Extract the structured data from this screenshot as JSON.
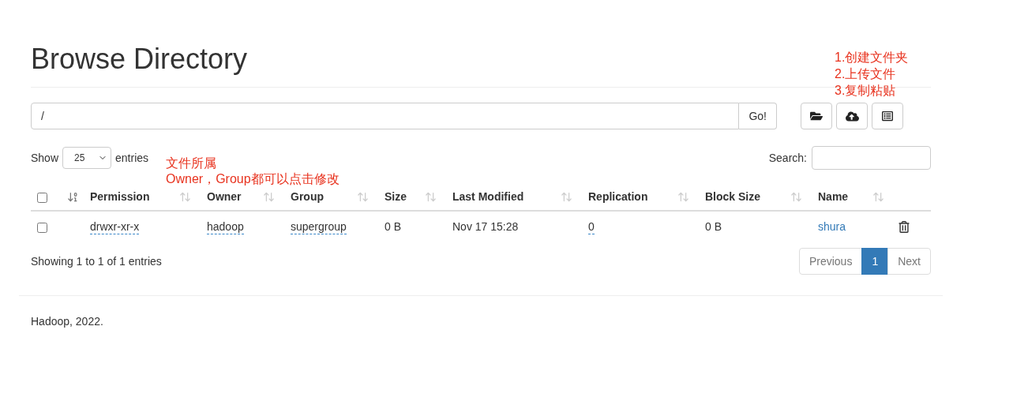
{
  "title": "Browse Directory",
  "path_field": {
    "value": "/"
  },
  "go_button": "Go!",
  "annotations": [
    {
      "lines": [
        "1.创建文件夹",
        "2.上传文件",
        "3.复制粘贴"
      ]
    },
    {
      "lines": [
        "文件所属",
        "Owner，Group都可以点击修改"
      ]
    }
  ],
  "length_control": {
    "before": "Show",
    "value": "25",
    "after": "entries"
  },
  "search": {
    "label": "Search:"
  },
  "select_all": {
    "checked": false
  },
  "columns": [
    {
      "sorted": true
    },
    {
      "label": "Permission",
      "sorted": false
    },
    {
      "label": "Owner",
      "sorted": false
    },
    {
      "label": "Group",
      "sorted": false
    },
    {
      "label": "Size",
      "sorted": false
    },
    {
      "label": "Last Modified",
      "sorted": false
    },
    {
      "label": "Replication",
      "sorted": false
    },
    {
      "label": "Block Size",
      "sorted": false
    },
    {
      "label": "Name",
      "sorted": false
    }
  ],
  "rows": [
    {
      "checked": false,
      "cells": [
        {
          "kind": "editable",
          "text": "drwxr-xr-x"
        },
        {
          "kind": "editable",
          "text": "hadoop"
        },
        {
          "kind": "editable",
          "text": "supergroup"
        },
        {
          "kind": "plain",
          "text": "0 B"
        },
        {
          "kind": "plain",
          "text": "Nov 17 15:28"
        },
        {
          "kind": "editable",
          "text": "0"
        },
        {
          "kind": "plain",
          "text": "0 B"
        },
        {
          "kind": "link",
          "text": "shura"
        }
      ]
    }
  ],
  "info": "Showing 1 to 1 of 1 entries",
  "pagination": [
    {
      "label": "Previous",
      "selected": false
    },
    {
      "label": "1",
      "selected": true
    },
    {
      "label": "Next",
      "selected": false
    }
  ],
  "footer": "Hadoop, 2022."
}
